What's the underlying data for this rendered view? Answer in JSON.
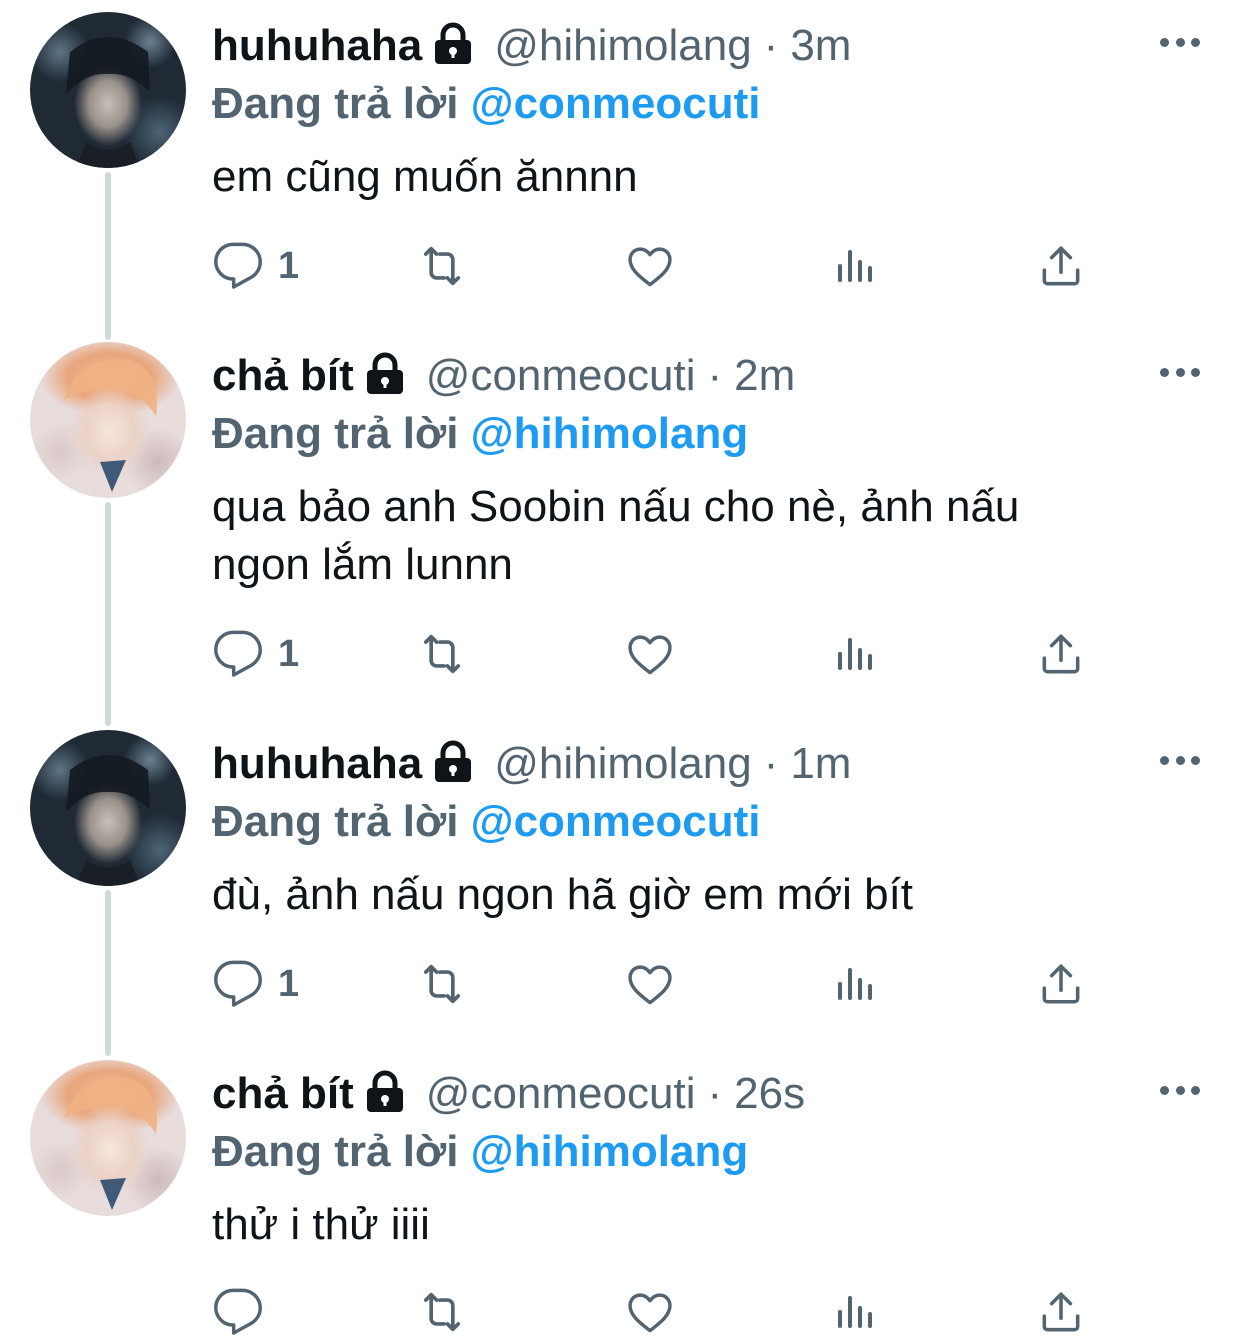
{
  "replying_prefix": "Đang trả lời",
  "tweets": [
    {
      "name": "huhuhaha",
      "handle": "@hihimolang",
      "separator": "·",
      "time": "3m",
      "mention": "@conmeocuti",
      "lines": [
        "em cũng muốn ănnnn"
      ],
      "reply_count": "1",
      "avatar": "dark-haired-boy"
    },
    {
      "name": "chả bít",
      "handle": "@conmeocuti",
      "separator": "·",
      "time": "2m",
      "mention": "@hihimolang",
      "lines": [
        "qua bảo anh Soobin nấu cho nè, ảnh nấu",
        "ngon lắm lunnn"
      ],
      "reply_count": "1",
      "avatar": "orange-haired-boy"
    },
    {
      "name": "huhuhaha",
      "handle": "@hihimolang",
      "separator": "·",
      "time": "1m",
      "mention": "@conmeocuti",
      "lines": [
        "đù, ảnh nấu ngon hã giờ em mới bít"
      ],
      "reply_count": "1",
      "avatar": "dark-haired-boy"
    },
    {
      "name": "chả bít",
      "handle": "@conmeocuti",
      "separator": "·",
      "time": "26s",
      "mention": "@hihimolang",
      "lines": [
        "thử i thử iiii"
      ],
      "reply_count": "",
      "avatar": "orange-haired-boy"
    }
  ],
  "icons": {
    "lock": "lock-icon",
    "more": "more-icon",
    "reply": "reply-icon",
    "retweet": "retweet-icon",
    "like": "like-icon",
    "analytics": "analytics-icon",
    "share": "share-icon"
  },
  "colors": {
    "text": "#0f1419",
    "secondary": "#536471",
    "mention": "#1d9bf0",
    "thread_line": "#cfd9de"
  }
}
